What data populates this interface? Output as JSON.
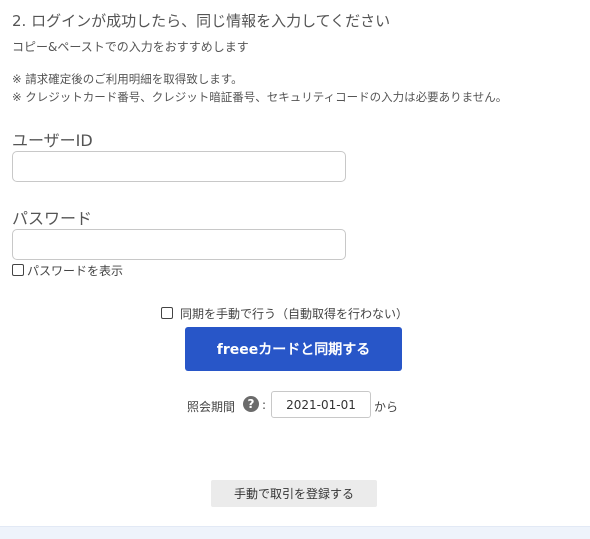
{
  "step": {
    "title": "2. ログインが成功したら、同じ情報を入力してください",
    "subtitle": "コピー&ペーストでの入力をおすすめします"
  },
  "notes": [
    "※ 請求確定後のご利用明細を取得致します。",
    "※ クレジットカード番号、クレジット暗証番号、セキュリティコードの入力は必要ありません。"
  ],
  "form": {
    "user_id_label": "ユーザーID",
    "user_id_value": "",
    "password_label": "パスワード",
    "password_value": "",
    "show_password_label": "パスワードを表示",
    "show_password_checked": false
  },
  "sync": {
    "manual_sync_label": "同期を手動で行う（自動取得を行わない）",
    "manual_sync_checked": false,
    "button_label": "freeeカードと同期する"
  },
  "period": {
    "label": "照会期間",
    "help_icon": "question-circle-icon",
    "colon": ":",
    "start_date": "2021-01-01",
    "suffix": "から"
  },
  "manual_entry_button": "手動で取引を登録する",
  "colors": {
    "primary": "#2856c8",
    "secondary_button": "#ebebeb"
  }
}
